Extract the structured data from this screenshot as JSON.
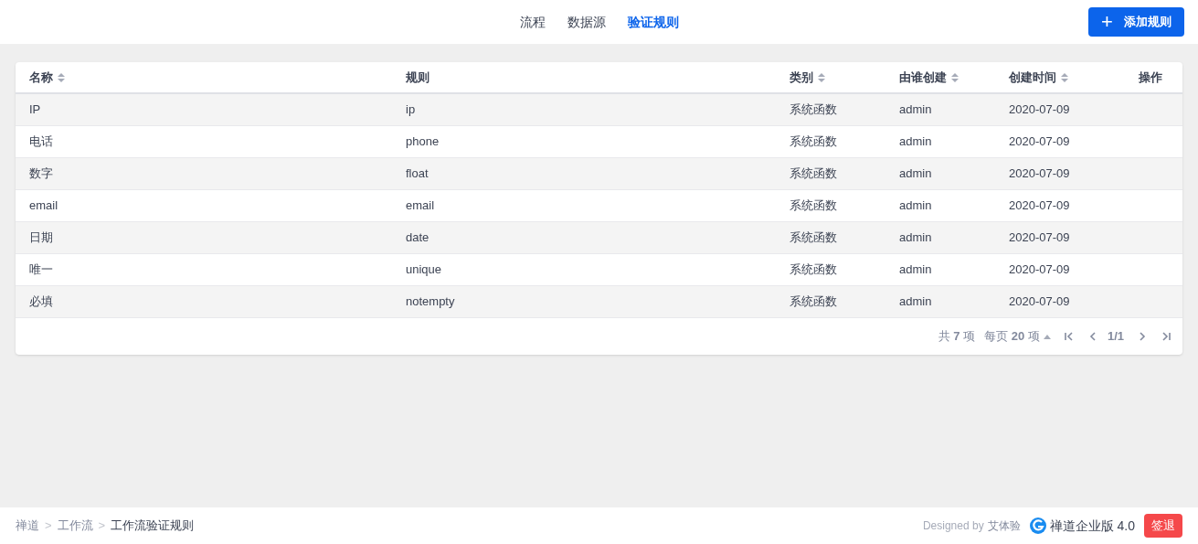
{
  "nav": {
    "tabs": [
      {
        "label": "流程",
        "selected": false
      },
      {
        "label": "数据源",
        "selected": false
      },
      {
        "label": "验证规则",
        "selected": true
      }
    ],
    "add_button": {
      "icon": "+",
      "label": "添加规则"
    }
  },
  "table": {
    "columns": [
      {
        "label": "名称",
        "sortable": true
      },
      {
        "label": "规则",
        "sortable": false
      },
      {
        "label": "类别",
        "sortable": true
      },
      {
        "label": "由谁创建",
        "sortable": true
      },
      {
        "label": "创建时间",
        "sortable": true
      },
      {
        "label": "操作",
        "sortable": false
      }
    ],
    "rows": [
      [
        "IP",
        "ip",
        "系统函数",
        "admin",
        "2020-07-09"
      ],
      [
        "电话",
        "phone",
        "系统函数",
        "admin",
        "2020-07-09"
      ],
      [
        "数字",
        "float",
        "系统函数",
        "admin",
        "2020-07-09"
      ],
      [
        "email",
        "email",
        "系统函数",
        "admin",
        "2020-07-09"
      ],
      [
        "日期",
        "date",
        "系统函数",
        "admin",
        "2020-07-09"
      ],
      [
        "唯一",
        "unique",
        "系统函数",
        "admin",
        "2020-07-09"
      ],
      [
        "必填",
        "notempty",
        "系统函数",
        "admin",
        "2020-07-09"
      ]
    ]
  },
  "pager": {
    "total": "共 **7** 项",
    "per_page": "每页 **20** 项",
    "page": "1/1"
  },
  "footer": {
    "breadcrumb": [
      "禅道",
      "工作流",
      "工作流验证规则"
    ],
    "separator": ">",
    "designed_by": "Designed by",
    "designer": "艾体验",
    "product": "禅道企业版 4.0",
    "logout": "签退"
  }
}
